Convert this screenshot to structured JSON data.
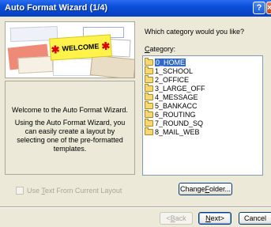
{
  "window": {
    "title": "Auto Format Wizard (1/4)"
  },
  "titlebar": {
    "help_label": "?",
    "close_label": "×"
  },
  "banner": {
    "welcome_text": "WELCOME",
    "star": "✱"
  },
  "info": {
    "paragraph1": "Welcome to the Auto Format Wizard.",
    "paragraph2": "Using the Auto Format Wizard, you can easily create a layout by selecting one of the pre-formatted templates."
  },
  "question": "Which category would you like?",
  "category": {
    "label_accel": "C",
    "label_rest": "ategory:"
  },
  "categories": [
    {
      "label": "0_HOME",
      "selected": true
    },
    {
      "label": "1_SCHOOL"
    },
    {
      "label": "2_OFFICE"
    },
    {
      "label": "3_LARGE_OFF"
    },
    {
      "label": "4_MESSAGE"
    },
    {
      "label": "5_BANKACC"
    },
    {
      "label": "6_ROUTING"
    },
    {
      "label": "7_ROUND_SQ"
    },
    {
      "label": "8_MAIL_WEB"
    }
  ],
  "change_folder": {
    "pre": "Change ",
    "accel": "F",
    "post": "older..."
  },
  "use_text": {
    "pre": "Use ",
    "accel": "T",
    "post": "ext From Current Layout",
    "checked": false
  },
  "buttons": {
    "back": {
      "pre": "< ",
      "accel": "B",
      "post": "ack"
    },
    "next": {
      "accel": "N",
      "post": "ext>"
    },
    "cancel": "Cancel"
  }
}
